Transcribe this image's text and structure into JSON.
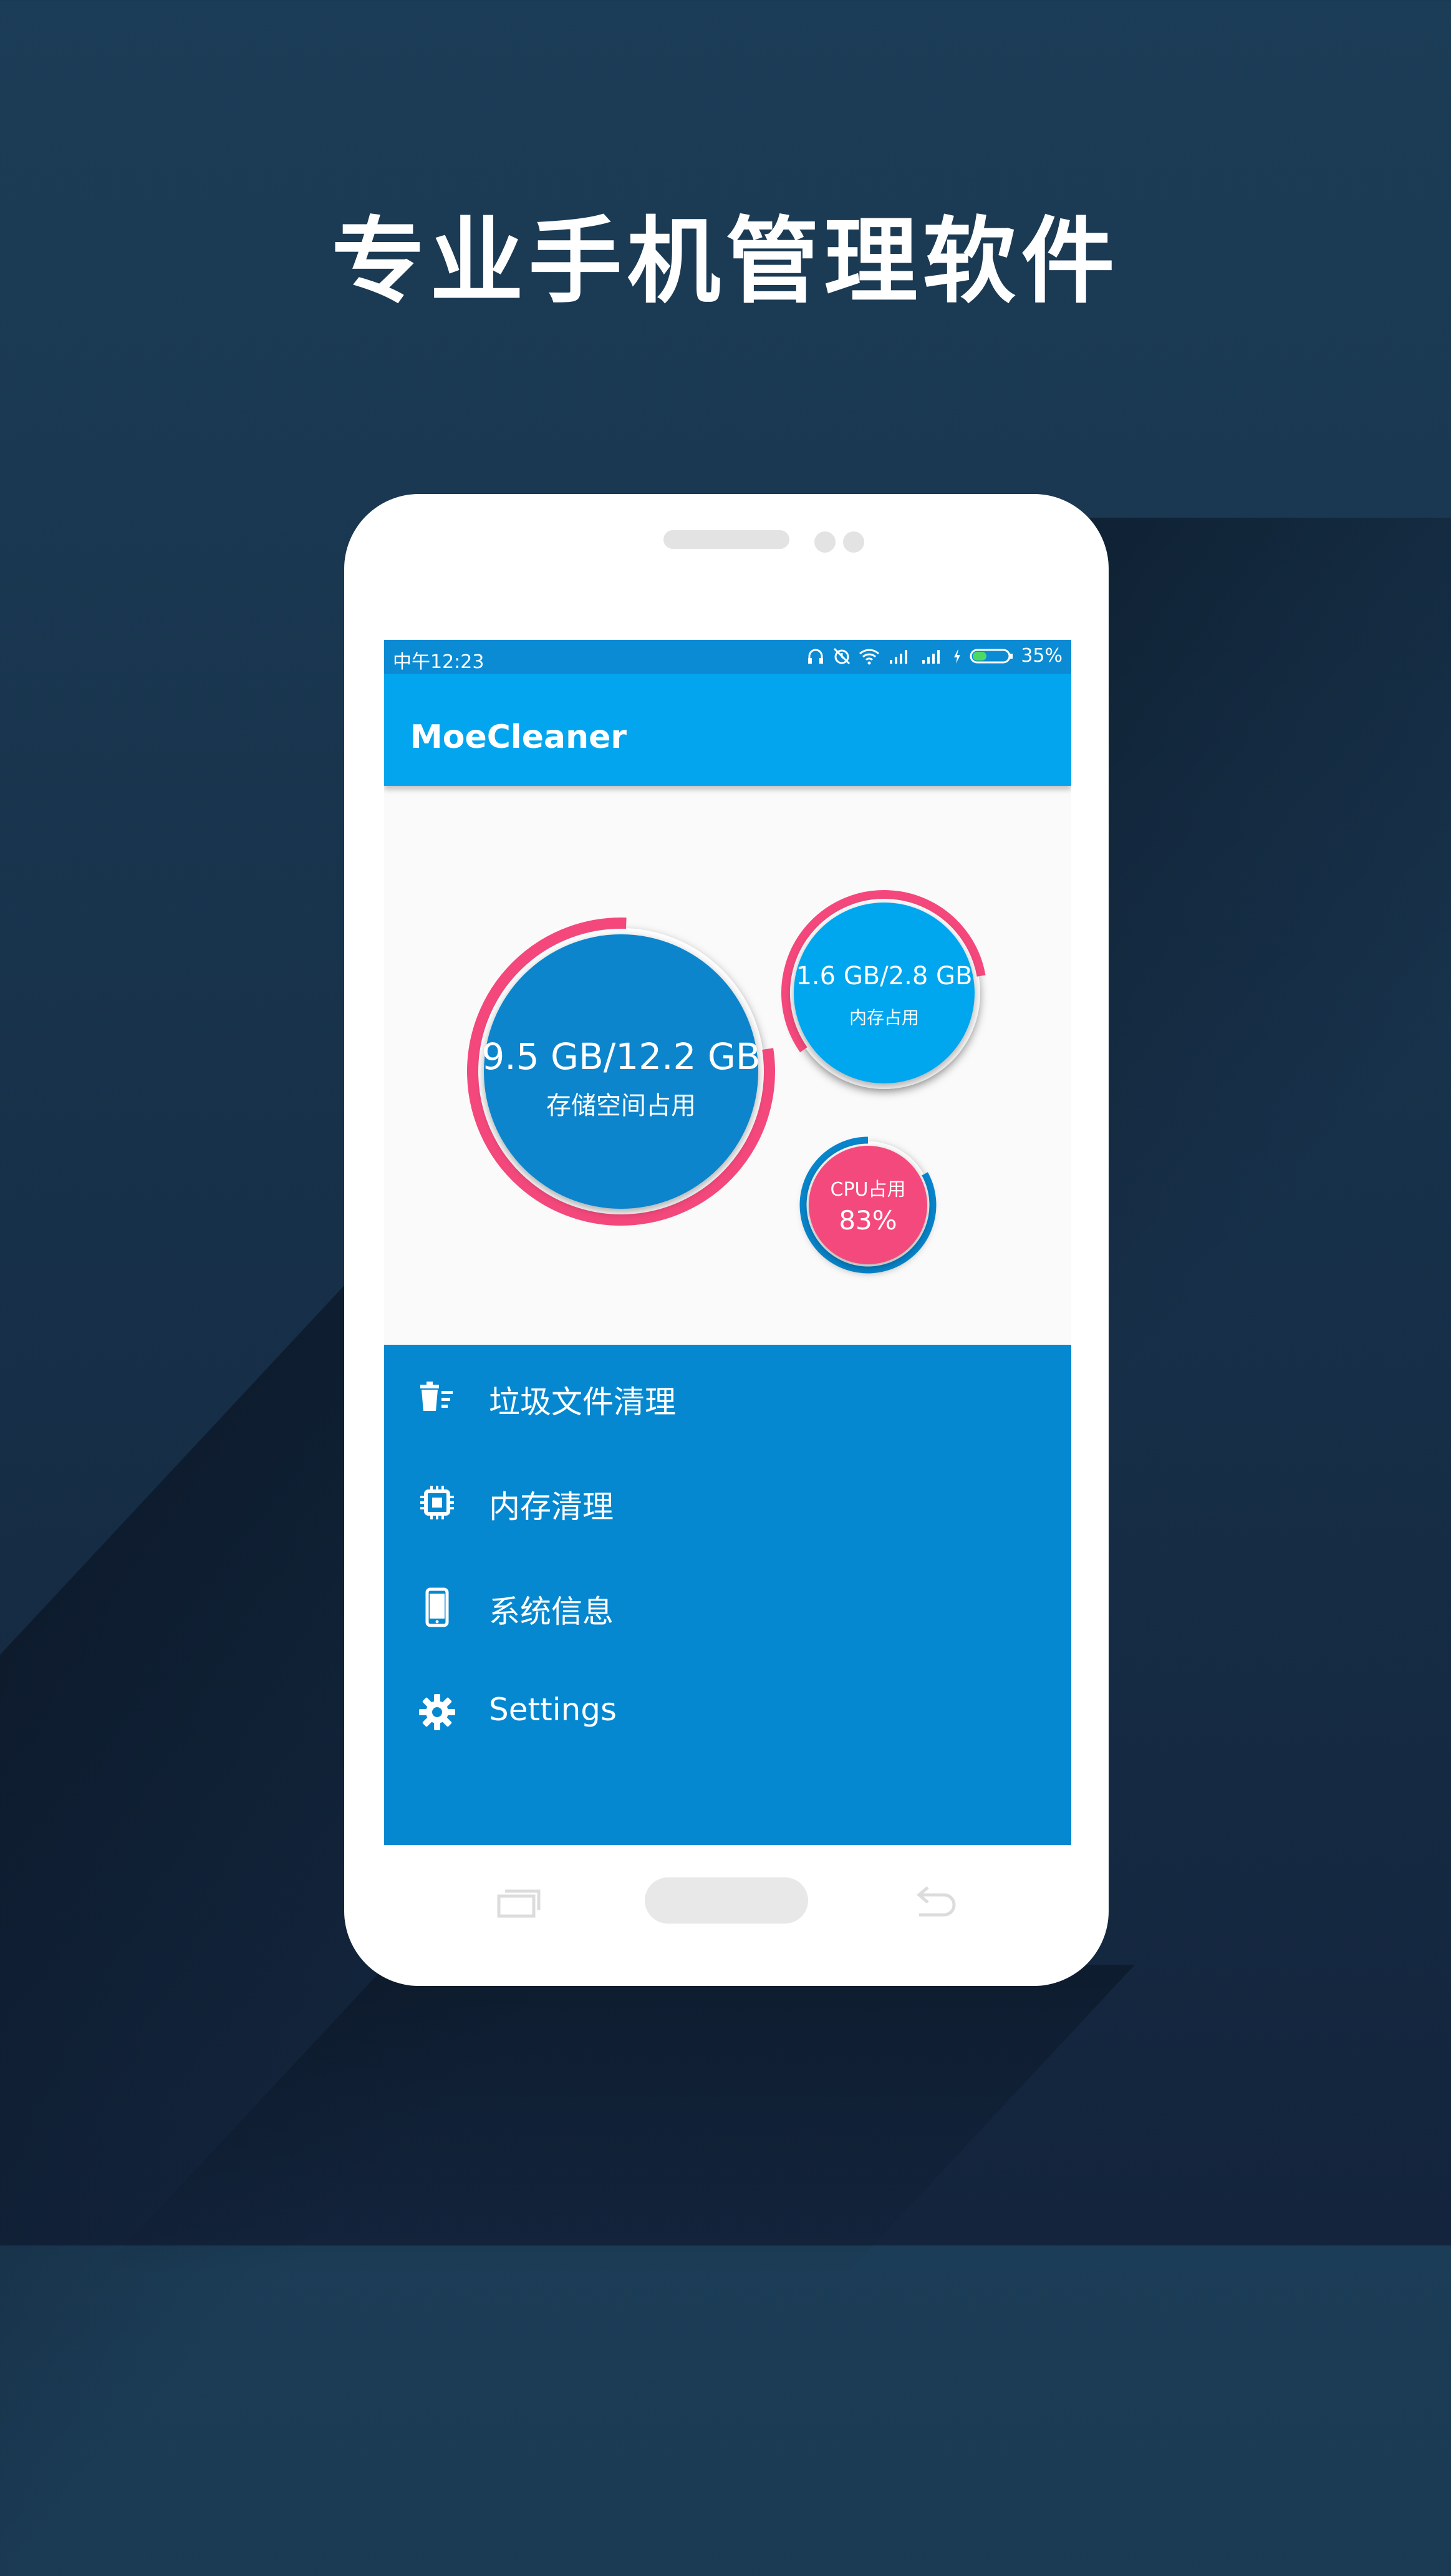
{
  "headline": "专业手机管理软件",
  "status_bar": {
    "time": "中午12:23",
    "battery_percent": "35%"
  },
  "app_bar": {
    "title": "MoeCleaner"
  },
  "dashboard": {
    "storage": {
      "value": "9.5 GB/12.2 GB",
      "label": "存储空间占用",
      "used_fraction": 0.78,
      "fill_color": "#0785cc",
      "ring_color": "#f4487c"
    },
    "memory": {
      "value": "1.6 GB/2.8 GB",
      "label": "内存占用",
      "used_fraction": 0.57,
      "fill_color": "#03a6ee",
      "ring_color": "#f4487c"
    },
    "cpu": {
      "label": "CPU占用",
      "value": "83%",
      "used_fraction": 0.83,
      "fill_color": "#f4487c",
      "ring_color": "#0785cc"
    }
  },
  "menu": {
    "items": [
      {
        "icon": "trash-icon",
        "label": "垃圾文件清理"
      },
      {
        "icon": "chip-icon",
        "label": "内存清理"
      },
      {
        "icon": "phone-icon",
        "label": "系统信息"
      },
      {
        "icon": "gear-icon",
        "label": "Settings"
      }
    ]
  },
  "colors": {
    "background": "#1a3650",
    "status_bar": "#0a8bd3",
    "app_bar": "#03a6ee",
    "menu": "#0688d1",
    "accent_pink": "#f4487c"
  }
}
